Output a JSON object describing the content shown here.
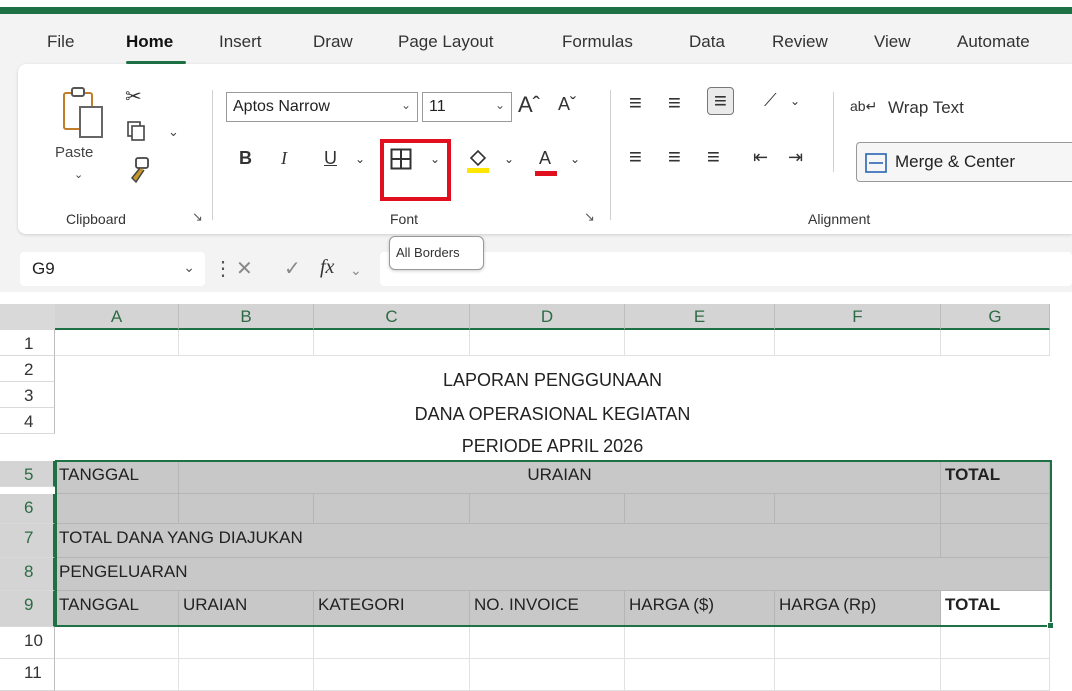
{
  "menu": [
    "File",
    "Home",
    "Insert",
    "Draw",
    "Page Layout",
    "Formulas",
    "Data",
    "Review",
    "View",
    "Automate"
  ],
  "clipboard": {
    "paste_label": "Paste",
    "group_label": "Clipboard"
  },
  "font": {
    "name": "Aptos Narrow",
    "size": "11",
    "bold": "B",
    "italic": "I",
    "underline": "U",
    "grow": "Aˆ",
    "shrink": "Aˇ",
    "font_color": "A",
    "group_label": "Font"
  },
  "alignment": {
    "wrap_text": "Wrap Text",
    "merge_center": "Merge & Center",
    "group_label": "Alignment"
  },
  "tooltip": "All Borders",
  "formula_bar": {
    "name_box": "G9",
    "fx": "fx"
  },
  "columns": [
    "A",
    "B",
    "C",
    "D",
    "E",
    "F",
    "G"
  ],
  "rows": [
    "1",
    "2",
    "3",
    "4",
    "5",
    "6",
    "7",
    "8",
    "9",
    "10",
    "11"
  ],
  "sheet": {
    "title1": "LAPORAN PENGGUNAAN",
    "title2": "DANA OPERASIONAL KEGIATAN",
    "title3": "PERIODE APRIL 2026",
    "r5": {
      "a": "TANGGAL",
      "merged": "URAIAN",
      "g": "TOTAL"
    },
    "r7": "TOTAL DANA YANG DIAJUKAN",
    "r8": "PENGELUARAN",
    "r9": [
      "TANGGAL",
      "URAIAN",
      "KATEGORI",
      "NO. INVOICE",
      "HARGA ($)",
      "HARGA (Rp)",
      "TOTAL"
    ]
  },
  "colors": {
    "excel_green": "#1e7145",
    "highlight_red": "#e0101e",
    "header_gray": "#c8c8c8"
  }
}
